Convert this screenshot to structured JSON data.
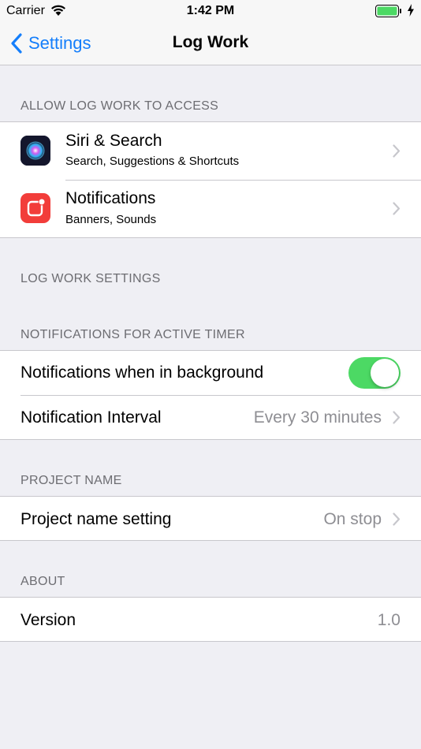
{
  "status_bar": {
    "carrier": "Carrier",
    "time": "1:42 PM",
    "battery_color": "#4cd964"
  },
  "nav": {
    "back_label": "Settings",
    "title": "Log Work",
    "accent_color": "#147efb"
  },
  "sections": {
    "access": {
      "header": "ALLOW LOG WORK TO ACCESS",
      "items": [
        {
          "title": "Siri & Search",
          "subtitle": "Search, Suggestions & Shortcuts",
          "icon": "siri-icon"
        },
        {
          "title": "Notifications",
          "subtitle": "Banners, Sounds",
          "icon": "notifications-app-icon"
        }
      ]
    },
    "settings": {
      "header": "LOG WORK SETTINGS"
    },
    "timer": {
      "header": "NOTIFICATIONS FOR ACTIVE TIMER",
      "background_label": "Notifications when in background",
      "background_enabled": true,
      "interval_label": "Notification Interval",
      "interval_value": "Every 30 minutes"
    },
    "project": {
      "header": "PROJECT NAME",
      "setting_label": "Project name setting",
      "setting_value": "On stop"
    },
    "about": {
      "header": "ABOUT",
      "version_label": "Version",
      "version_value": "1.0"
    }
  }
}
